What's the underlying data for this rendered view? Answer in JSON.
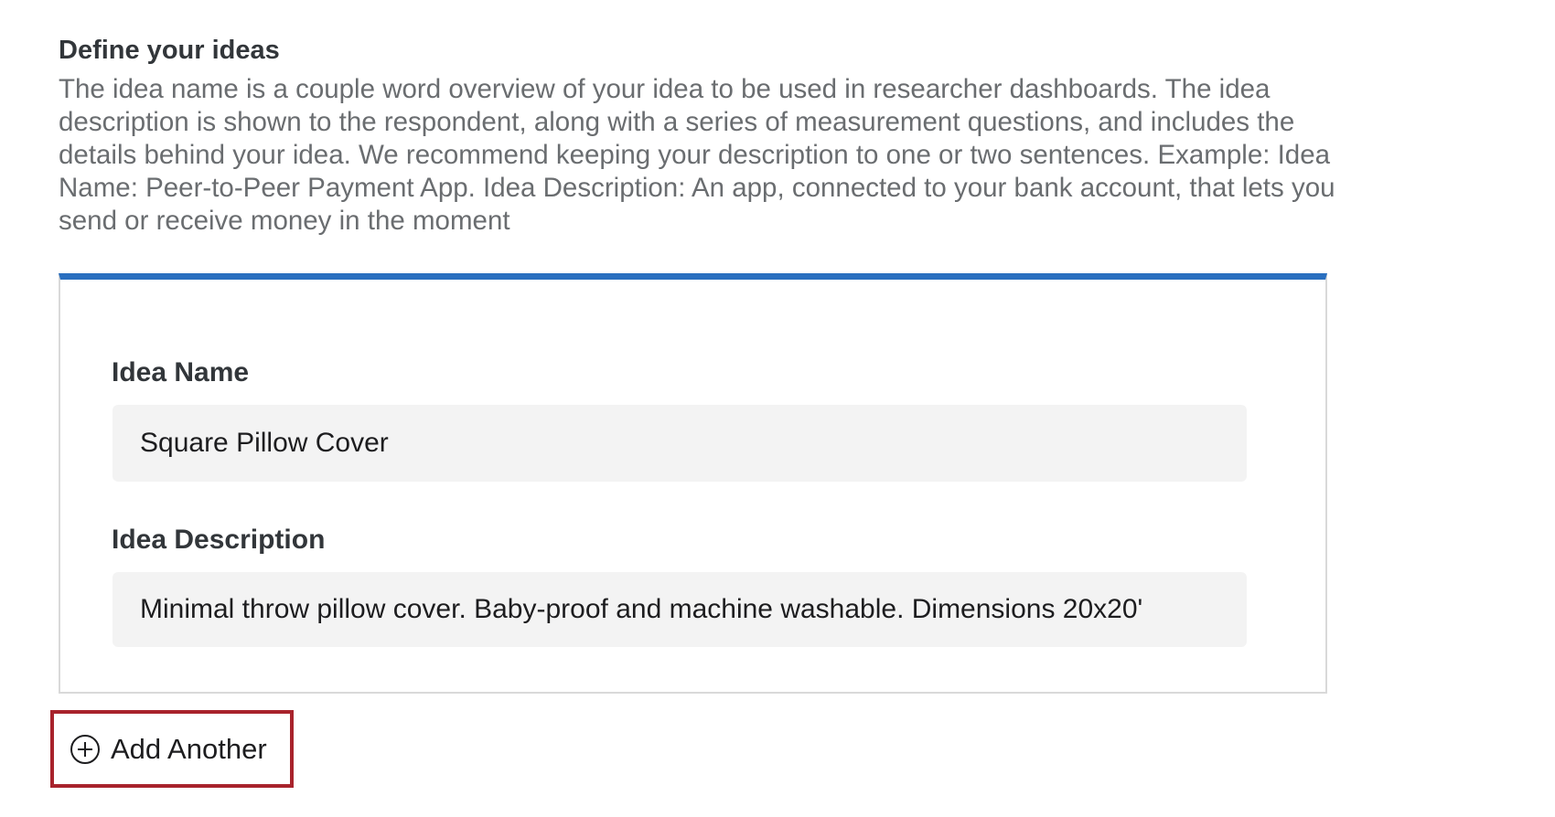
{
  "section": {
    "title": "Define your ideas",
    "description": "The idea name is a couple word overview of your idea to be used in researcher dashboards. The idea description is shown to the respondent, along with a series of measurement questions, and includes the details behind your idea. We recommend keeping your description to one or two sentences. Example: Idea Name: Peer-to-Peer Payment App. Idea Description: An app, connected to your bank account, that lets you send or receive money in the moment"
  },
  "idea": {
    "name_label": "Idea Name",
    "name_value": "Square Pillow Cover",
    "description_label": "Idea Description",
    "description_value": "Minimal throw pillow cover. Baby-proof and machine washable. Dimensions 20x20'"
  },
  "actions": {
    "add_another_label": "Add Another",
    "add_another_icon": "plus-circle-icon",
    "highlight_color": "#a8232c"
  },
  "colors": {
    "card_accent": "#2a6fbf",
    "input_background": "#f3f3f3"
  }
}
